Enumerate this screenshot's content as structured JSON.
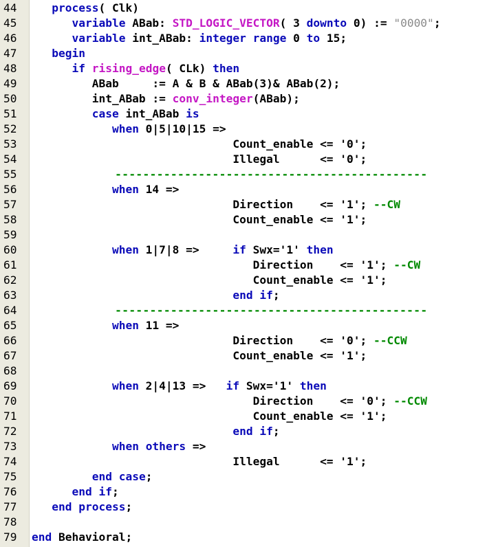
{
  "colors": {
    "keyword": "#0a0ab8",
    "function": "#c416c4",
    "comment": "#008a00",
    "string": "#8a8a8a",
    "text": "#000000",
    "gutter": "#ecebe0"
  },
  "lines": [
    {
      "n": "44",
      "tokens": [
        {
          "t": "   ",
          "c": "txt"
        },
        {
          "t": "process",
          "c": "kw"
        },
        {
          "t": "( Clk)",
          "c": "txt"
        }
      ]
    },
    {
      "n": "45",
      "tokens": [
        {
          "t": "      ",
          "c": "txt"
        },
        {
          "t": "variable",
          "c": "kw"
        },
        {
          "t": " ABab: ",
          "c": "txt"
        },
        {
          "t": "STD_LOGIC_VECTOR",
          "c": "fn"
        },
        {
          "t": "( 3 ",
          "c": "txt"
        },
        {
          "t": "downto",
          "c": "kw"
        },
        {
          "t": " 0) := ",
          "c": "txt"
        },
        {
          "t": "\"0000\"",
          "c": "str"
        },
        {
          "t": ";",
          "c": "txt"
        }
      ]
    },
    {
      "n": "46",
      "tokens": [
        {
          "t": "      ",
          "c": "txt"
        },
        {
          "t": "variable",
          "c": "kw"
        },
        {
          "t": " int_ABab: ",
          "c": "txt"
        },
        {
          "t": "integer",
          "c": "kw"
        },
        {
          "t": " ",
          "c": "txt"
        },
        {
          "t": "range",
          "c": "kw"
        },
        {
          "t": " 0 ",
          "c": "txt"
        },
        {
          "t": "to",
          "c": "kw"
        },
        {
          "t": " 15;",
          "c": "txt"
        }
      ]
    },
    {
      "n": "47",
      "tokens": [
        {
          "t": "   ",
          "c": "txt"
        },
        {
          "t": "begin",
          "c": "kw"
        }
      ]
    },
    {
      "n": "48",
      "tokens": [
        {
          "t": "      ",
          "c": "txt"
        },
        {
          "t": "if",
          "c": "kw"
        },
        {
          "t": " ",
          "c": "txt"
        },
        {
          "t": "rising_edge",
          "c": "fn"
        },
        {
          "t": "( CLk) ",
          "c": "txt"
        },
        {
          "t": "then",
          "c": "kw"
        }
      ]
    },
    {
      "n": "49",
      "tokens": [
        {
          "t": "         ABab     := A & B & ABab(3)& ABab(2);",
          "c": "txt"
        }
      ]
    },
    {
      "n": "50",
      "tokens": [
        {
          "t": "         int_ABab := ",
          "c": "txt"
        },
        {
          "t": "conv_integer",
          "c": "fn"
        },
        {
          "t": "(ABab);",
          "c": "txt"
        }
      ]
    },
    {
      "n": "51",
      "tokens": [
        {
          "t": "         ",
          "c": "txt"
        },
        {
          "t": "case",
          "c": "kw"
        },
        {
          "t": " int_ABab ",
          "c": "txt"
        },
        {
          "t": "is",
          "c": "kw"
        }
      ]
    },
    {
      "n": "52",
      "tokens": [
        {
          "t": "            ",
          "c": "txt"
        },
        {
          "t": "when",
          "c": "kw"
        },
        {
          "t": " 0|5|10|15 =>",
          "c": "txt"
        }
      ]
    },
    {
      "n": "53",
      "tokens": [
        {
          "t": "                              Count_enable <= '0';",
          "c": "txt"
        }
      ]
    },
    {
      "n": "54",
      "tokens": [
        {
          "t": "                              Illegal      <= '0';",
          "c": "txt"
        }
      ]
    },
    {
      "n": "55",
      "tokens": [
        {
          "t": "            ---------------------------------------------",
          "c": "sep"
        }
      ]
    },
    {
      "n": "56",
      "tokens": [
        {
          "t": "            ",
          "c": "txt"
        },
        {
          "t": "when",
          "c": "kw"
        },
        {
          "t": " 14 =>",
          "c": "txt"
        }
      ]
    },
    {
      "n": "57",
      "tokens": [
        {
          "t": "                              Direction    <= '1'; ",
          "c": "txt"
        },
        {
          "t": "--CW",
          "c": "cm"
        }
      ]
    },
    {
      "n": "58",
      "tokens": [
        {
          "t": "                              Count_enable <= '1';",
          "c": "txt"
        }
      ]
    },
    {
      "n": "59",
      "tokens": []
    },
    {
      "n": "60",
      "tokens": [
        {
          "t": "            ",
          "c": "txt"
        },
        {
          "t": "when",
          "c": "kw"
        },
        {
          "t": " 1|7|8 =>     ",
          "c": "txt"
        },
        {
          "t": "if",
          "c": "kw"
        },
        {
          "t": " Swx='1' ",
          "c": "txt"
        },
        {
          "t": "then",
          "c": "kw"
        }
      ]
    },
    {
      "n": "61",
      "tokens": [
        {
          "t": "                                 Direction    <= '1'; ",
          "c": "txt"
        },
        {
          "t": "--CW",
          "c": "cm"
        }
      ]
    },
    {
      "n": "62",
      "tokens": [
        {
          "t": "                                 Count_enable <= '1';",
          "c": "txt"
        }
      ]
    },
    {
      "n": "63",
      "tokens": [
        {
          "t": "                              ",
          "c": "txt"
        },
        {
          "t": "end if",
          "c": "kw"
        },
        {
          "t": ";",
          "c": "txt"
        }
      ]
    },
    {
      "n": "64",
      "tokens": [
        {
          "t": "            ---------------------------------------------",
          "c": "sep"
        }
      ]
    },
    {
      "n": "65",
      "tokens": [
        {
          "t": "            ",
          "c": "txt"
        },
        {
          "t": "when",
          "c": "kw"
        },
        {
          "t": " 11 =>",
          "c": "txt"
        }
      ]
    },
    {
      "n": "66",
      "tokens": [
        {
          "t": "                              Direction    <= '0'; ",
          "c": "txt"
        },
        {
          "t": "--CCW",
          "c": "cm"
        }
      ]
    },
    {
      "n": "67",
      "tokens": [
        {
          "t": "                              Count_enable <= '1';",
          "c": "txt"
        }
      ]
    },
    {
      "n": "68",
      "tokens": []
    },
    {
      "n": "69",
      "tokens": [
        {
          "t": "            ",
          "c": "txt"
        },
        {
          "t": "when",
          "c": "kw"
        },
        {
          "t": " 2|4|13 =>   ",
          "c": "txt"
        },
        {
          "t": "if",
          "c": "kw"
        },
        {
          "t": " Swx='1' ",
          "c": "txt"
        },
        {
          "t": "then",
          "c": "kw"
        }
      ]
    },
    {
      "n": "70",
      "tokens": [
        {
          "t": "                                 Direction    <= '0'; ",
          "c": "txt"
        },
        {
          "t": "--CCW",
          "c": "cm"
        }
      ]
    },
    {
      "n": "71",
      "tokens": [
        {
          "t": "                                 Count_enable <= '1';",
          "c": "txt"
        }
      ]
    },
    {
      "n": "72",
      "tokens": [
        {
          "t": "                              ",
          "c": "txt"
        },
        {
          "t": "end if",
          "c": "kw"
        },
        {
          "t": ";",
          "c": "txt"
        }
      ]
    },
    {
      "n": "73",
      "tokens": [
        {
          "t": "            ",
          "c": "txt"
        },
        {
          "t": "when",
          "c": "kw"
        },
        {
          "t": " ",
          "c": "txt"
        },
        {
          "t": "others",
          "c": "kw"
        },
        {
          "t": " =>",
          "c": "txt"
        }
      ]
    },
    {
      "n": "74",
      "tokens": [
        {
          "t": "                              Illegal      <= '1';",
          "c": "txt"
        }
      ]
    },
    {
      "n": "75",
      "tokens": [
        {
          "t": "         ",
          "c": "txt"
        },
        {
          "t": "end case",
          "c": "kw"
        },
        {
          "t": ";",
          "c": "txt"
        }
      ]
    },
    {
      "n": "76",
      "tokens": [
        {
          "t": "      ",
          "c": "txt"
        },
        {
          "t": "end if",
          "c": "kw"
        },
        {
          "t": ";",
          "c": "txt"
        }
      ]
    },
    {
      "n": "77",
      "tokens": [
        {
          "t": "   ",
          "c": "txt"
        },
        {
          "t": "end process",
          "c": "kw"
        },
        {
          "t": ";",
          "c": "txt"
        }
      ]
    },
    {
      "n": "78",
      "tokens": []
    },
    {
      "n": "79",
      "tokens": [
        {
          "t": "end",
          "c": "kw"
        },
        {
          "t": " Behavioral;",
          "c": "txt"
        }
      ]
    }
  ]
}
